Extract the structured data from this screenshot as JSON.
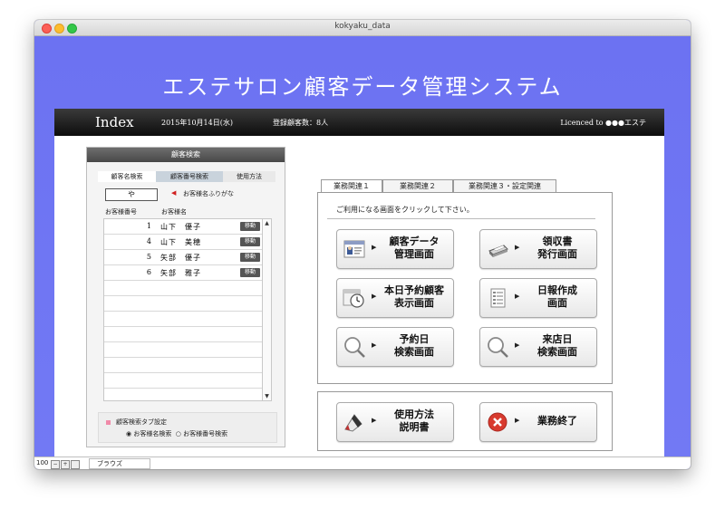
{
  "window": {
    "title": "kokyaku_data"
  },
  "app": {
    "title": "エステサロン顧客データ管理システム"
  },
  "header": {
    "index_label": "Index",
    "date": "2015年10月14日(水)",
    "registered": "登録顧客数：8人",
    "licence": "Licenced to ●●●エステ"
  },
  "search_panel": {
    "title": "顧客検索",
    "tabs": [
      "顧客名検索",
      "顧客番号検索",
      "使用方法"
    ],
    "search_value": "や",
    "search_label": "お客様名ふりがな",
    "columns": [
      "お客様番号",
      "お客様名"
    ],
    "rows": [
      {
        "num": "1",
        "name": "山下　優子",
        "action": "移動"
      },
      {
        "num": "4",
        "name": "山下　美穂",
        "action": "移動"
      },
      {
        "num": "5",
        "name": "矢部　優子",
        "action": "移動"
      },
      {
        "num": "6",
        "name": "矢部　雅子",
        "action": "移動"
      }
    ],
    "tab_setting_title": "顧客検索タブ設定",
    "tab_setting_opt1": "お客様名検索",
    "tab_setting_opt2": "お客様番号検索"
  },
  "right_tabs": [
    "業務関連１",
    "業務関連２",
    "業務関連３・設定関連"
  ],
  "instruction": "ご利用になる画面をクリックして下さい。",
  "buttons": {
    "customer_data": {
      "line1": "顧客データ",
      "line2": "管理画面",
      "icon": "id-card-icon"
    },
    "receipt": {
      "line1": "領収書",
      "line2": "発行画面",
      "icon": "printer-icon"
    },
    "today_reservations": {
      "line1": "本日予約顧客",
      "line2": "表示画面",
      "icon": "clock-icon"
    },
    "daily_report": {
      "line1": "日報作成",
      "line2": "画面",
      "icon": "report-icon"
    },
    "reservation_search": {
      "line1": "予約日",
      "line2": "検索画面",
      "icon": "magnifier-icon"
    },
    "visit_search": {
      "line1": "来店日",
      "line2": "検索画面",
      "icon": "magnifier-icon"
    },
    "manual": {
      "line1": "使用方法",
      "line2": "説明書",
      "icon": "pen-icon"
    },
    "quit": {
      "label": "業務終了",
      "icon": "close-circle-icon"
    }
  },
  "statusbar": {
    "zoom": "100",
    "mode": "ブラウズ"
  },
  "colors": {
    "background": "#6d74f0",
    "header_bar": "#111111",
    "quit_red": "#d83a2e"
  }
}
